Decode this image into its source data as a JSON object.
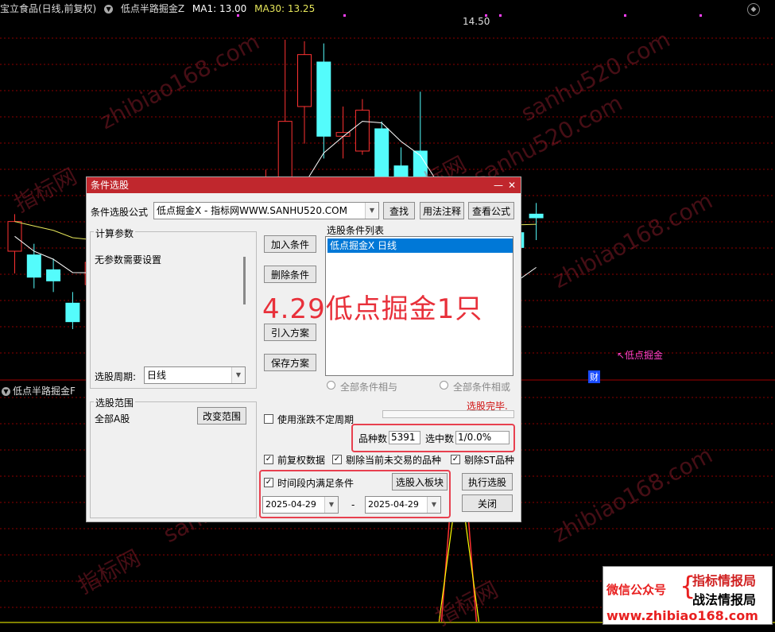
{
  "header": {
    "stock_name": "宝立食品(日线,前复权)",
    "indicator_name": "低点半路掘金Z",
    "ma1": "MA1: 13.00",
    "ma30": "MA30: 13.25",
    "ma1_color": "#ffffff",
    "ma30_color": "#e6e65a"
  },
  "chart_labels": {
    "high_price": "14.50",
    "signal_label": "↖低点掘金",
    "finance_mark": "财",
    "sub_indicator": "低点半路掘金F"
  },
  "dialog": {
    "title": "条件选股",
    "formula_label": "条件选股公式",
    "formula_value": "低点掘金X   - 指标网WWW.SANHU520.COM",
    "find_button": "查找",
    "usage_button": "用法注释",
    "view_button": "查看公式",
    "params_group": "计算参数",
    "params_text": "无参数需要设置",
    "period_label": "选股周期:",
    "period_value": "日线",
    "range_group": "选股范围",
    "range_value": "全部A股",
    "change_range_button": "改变范围",
    "add_condition_button": "加入条件",
    "delete_condition_button": "删除条件",
    "import_plan_button": "引入方案",
    "save_plan_button": "保存方案",
    "condition_list_label": "选股条件列表",
    "condition_item": "低点掘金X  日线",
    "radio_and": "全部条件相与",
    "radio_or": "全部条件相或",
    "status_text": "选股完毕.",
    "limit_checkbox": "使用涨跌不定周期",
    "count_label": "品种数",
    "count_value": "5391",
    "selected_label": "选中数",
    "selected_value": "1/0.0%",
    "option_adjusted": "前复权数据",
    "option_remove_untraded": "剔除当前未交易的品种",
    "option_remove_st": "剔除ST品种",
    "option_period": "时间段内满足条件",
    "to_block_button": "选股入板块",
    "execute_button": "执行选股",
    "close_button": "关闭",
    "date_from": "2025-04-29",
    "date_sep": "-",
    "date_to": "2025-04-29"
  },
  "annotation": "4.29低点掘金1只",
  "watermarks": [
    "zhibiao168.com",
    "sanhu520.com",
    "指标网",
    "sanhu520.com",
    "zhibiao168.com",
    "指标网",
    "sanhu520.com",
    "zhibiao168.com",
    "指标网",
    "指标网"
  ],
  "promo": {
    "wechat_label": "微信公众号",
    "line1": "指标情报局",
    "line2": "战法情报局",
    "url": "www.zhibiao168.com"
  },
  "chart_data": {
    "type": "candlestick",
    "candles": [
      {
        "o": 11.65,
        "c": 12.05,
        "h": 12.15,
        "l": 11.35
      },
      {
        "o": 11.6,
        "c": 11.3,
        "h": 11.75,
        "l": 11.15
      },
      {
        "o": 11.4,
        "c": 11.25,
        "h": 11.55,
        "l": 11.1
      },
      {
        "o": 10.95,
        "c": 10.7,
        "h": 11.1,
        "l": 10.6
      },
      {
        "o": 11.2,
        "c": 11.5,
        "h": 11.55,
        "l": 11.1
      },
      {
        "o": 11.35,
        "c": 11.45,
        "h": 11.55,
        "l": 11.2
      },
      {
        "o": 11.05,
        "c": 11.65,
        "h": 12.0,
        "l": 11.0
      },
      {
        "o": 11.7,
        "c": 11.9,
        "h": 12.1,
        "l": 11.4
      },
      {
        "o": 11.5,
        "c": 11.2,
        "h": 11.8,
        "l": 11.05
      },
      {
        "o": 11.55,
        "c": 11.75,
        "h": 11.9,
        "l": 11.4
      },
      {
        "o": 11.6,
        "c": 11.65,
        "h": 11.85,
        "l": 11.45
      },
      {
        "o": 11.5,
        "c": 11.7,
        "h": 11.85,
        "l": 11.4
      },
      {
        "o": 11.95,
        "c": 12.3,
        "h": 12.5,
        "l": 11.8
      },
      {
        "o": 12.0,
        "c": 12.5,
        "h": 12.75,
        "l": 11.9
      },
      {
        "o": 12.3,
        "c": 13.4,
        "h": 14.5,
        "l": 12.2
      },
      {
        "o": 13.6,
        "c": 14.3,
        "h": 14.48,
        "l": 13.1
      },
      {
        "o": 14.2,
        "c": 13.2,
        "h": 14.45,
        "l": 12.9
      },
      {
        "o": 13.2,
        "c": 13.25,
        "h": 13.6,
        "l": 12.9
      },
      {
        "o": 13.0,
        "c": 13.55,
        "h": 13.7,
        "l": 12.95
      },
      {
        "o": 13.3,
        "c": 12.2,
        "h": 13.4,
        "l": 12.1
      },
      {
        "o": 12.8,
        "c": 12.6,
        "h": 13.05,
        "l": 12.4
      },
      {
        "o": 13.0,
        "c": 12.5,
        "h": 13.8,
        "l": 12.45
      },
      {
        "o": 12.0,
        "c": 10.4,
        "h": 12.1,
        "l": 10.3
      },
      {
        "o": 10.4,
        "c": 11.15,
        "h": 11.2,
        "l": 10.38
      },
      {
        "o": 11.1,
        "c": 11.12,
        "h": 11.75,
        "l": 10.95
      },
      {
        "o": 11.25,
        "c": 11.45,
        "h": 11.85,
        "l": 11.05
      },
      {
        "o": 11.9,
        "c": 11.7,
        "h": 12.1,
        "l": 11.4
      },
      {
        "o": 12.15,
        "c": 12.1,
        "h": 12.3,
        "l": 11.8
      }
    ],
    "colors": {
      "up": "#ff3232",
      "down": "#54fcfc",
      "signal": "#ffff00",
      "ma1": "#ffffff",
      "ma30": "#e6e65a",
      "grid": "#8c0000",
      "sub_line": "#ff3232",
      "sub_line2": "#ffff00"
    },
    "signal_index": 23,
    "y_range": [
      10.0,
      14.8
    ]
  }
}
